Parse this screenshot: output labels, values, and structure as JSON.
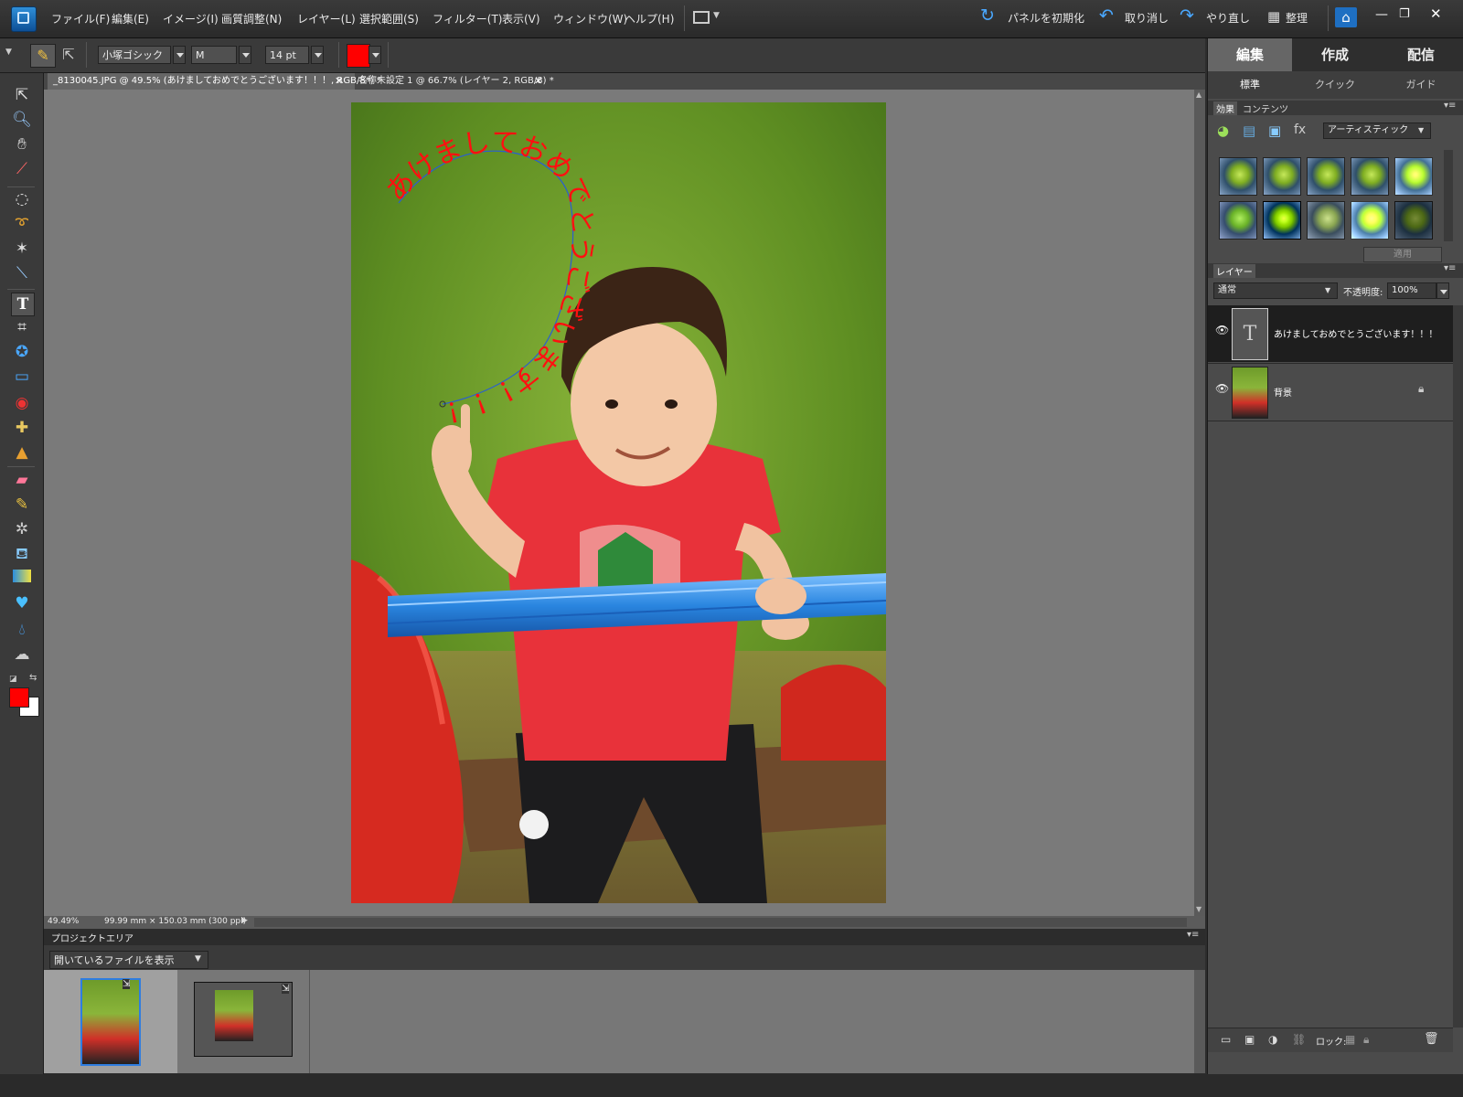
{
  "menubar": {
    "items": [
      "ファイル(F)",
      "編集(E)",
      "イメージ(I)",
      "画質調整(N)",
      "レイヤー(L)",
      "選択範囲(S)",
      "フィルター(T)",
      "表示(V)",
      "ウィンドウ(W)",
      "ヘルプ(H)"
    ],
    "reset_panels": "パネルを初期化",
    "undo": "取り消し",
    "redo": "やり直し",
    "organize": "整理"
  },
  "options": {
    "font_family": "小塚ゴシック ...",
    "font_style": "M",
    "font_size": "14 pt",
    "text_color": "#ff0000"
  },
  "tabs": [
    {
      "label": "_8130045.JPG @ 49.5% (あけましておめでとうございます！！！, RGB/8*) *",
      "active": true
    },
    {
      "label": "名称未設定 1 @ 66.7% (レイヤー 2, RGB/8) *",
      "active": false
    }
  ],
  "image": {
    "path_text": "あけましておめでとうございます！！！"
  },
  "status": {
    "zoom": "49.49%",
    "doc_size": "99.99 mm × 150.03 mm (300 ppi)"
  },
  "project_area": {
    "title": "プロジェクトエリア",
    "dropdown": "開いているファイルを表示"
  },
  "right_panel": {
    "mode_tabs": [
      "編集",
      "作成",
      "配信"
    ],
    "sub_tabs": [
      "標準",
      "クイック",
      "ガイド"
    ],
    "effects": {
      "tabs": [
        "効果",
        "コンテンツ"
      ],
      "category": "アーティスティック",
      "apply": "適用"
    },
    "layers": {
      "title": "レイヤー",
      "blend_mode": "通常",
      "opacity_label": "不透明度:",
      "opacity_value": "100%",
      "items": [
        {
          "name": "あけましておめでとうございます！！！",
          "type": "text",
          "thumb": "T"
        },
        {
          "name": "背景",
          "type": "image",
          "locked": true
        }
      ],
      "lock_label": "ロック:"
    }
  },
  "colors": {
    "foreground": "#ff0000",
    "background": "#ffffff",
    "accent": "#1e6fc2"
  }
}
